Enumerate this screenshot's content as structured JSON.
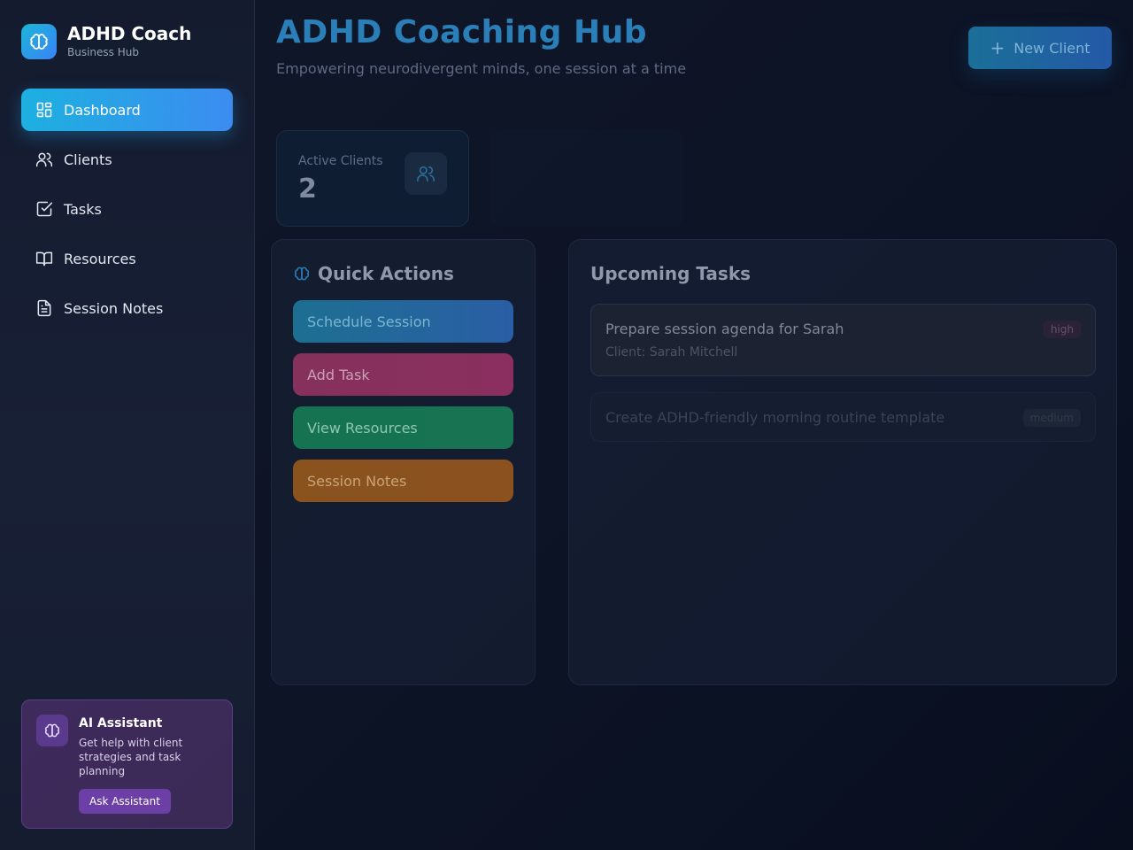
{
  "brand": {
    "title": "ADHD Coach",
    "subtitle": "Business Hub"
  },
  "nav": {
    "items": [
      {
        "label": "Dashboard",
        "icon": "dashboard-icon",
        "active": true
      },
      {
        "label": "Clients",
        "icon": "users-icon"
      },
      {
        "label": "Tasks",
        "icon": "check-square-icon"
      },
      {
        "label": "Resources",
        "icon": "book-icon"
      },
      {
        "label": "Session Notes",
        "icon": "document-icon"
      }
    ]
  },
  "ai_assistant": {
    "title": "AI Assistant",
    "description": "Get help with client strategies and task planning",
    "button_label": "Ask Assistant"
  },
  "header": {
    "title": "ADHD Coaching Hub",
    "subtitle": "Empowering neurodivergent minds, one session at a time",
    "new_client_label": "New Client"
  },
  "stats": [
    {
      "label": "Active Clients",
      "value": "2",
      "icon": "users-icon"
    }
  ],
  "quick_actions": {
    "title": "Quick Actions",
    "buttons": [
      "Schedule Session",
      "Add Task",
      "View Resources",
      "Session Notes"
    ]
  },
  "upcoming_tasks": {
    "title": "Upcoming Tasks",
    "items": [
      {
        "title": "Prepare session agenda for Sarah",
        "client": "Client: Sarah Mitchell",
        "priority": "high"
      },
      {
        "title": "Create ADHD-friendly morning routine template",
        "priority": "medium"
      }
    ]
  },
  "colors": {
    "accent": "#1db0e0",
    "accent_2": "#3c8cf0",
    "ai_card": "#3f2a5c"
  }
}
